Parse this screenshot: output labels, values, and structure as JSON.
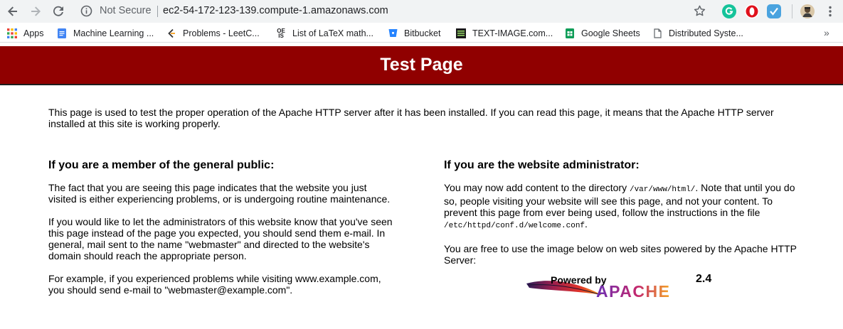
{
  "browser": {
    "security_label": "Not Secure",
    "url": "ec2-54-172-123-139.compute-1.amazonaws.com",
    "bookmarks": [
      {
        "label": "Apps",
        "icon": "apps-grid-icon"
      },
      {
        "label": "Machine Learning ...",
        "icon": "google-docs-icon"
      },
      {
        "label": "Problems - LeetC...",
        "icon": "leetcode-icon"
      },
      {
        "label": "List of LaTeX math...",
        "icon": "oeis-icon"
      },
      {
        "label": "Bitbucket",
        "icon": "bitbucket-icon"
      },
      {
        "label": "TEXT-IMAGE.com...",
        "icon": "text-image-icon"
      },
      {
        "label": "Google Sheets",
        "icon": "google-sheets-icon"
      },
      {
        "label": "Distributed Syste...",
        "icon": "page-icon"
      }
    ],
    "more_label": "»"
  },
  "page": {
    "title": "Test Page",
    "intro": "This page is used to test the proper operation of the Apache HTTP server after it has been installed. If you can read this page, it means that the Apache HTTP server installed at this site is working properly.",
    "public": {
      "heading": "If you are a member of the general public:",
      "p1": "The fact that you are seeing this page indicates that the website you just visited is either experiencing problems, or is undergoing routine maintenance.",
      "p2": "If you would like to let the administrators of this website know that you've seen this page instead of the page you expected, you should send them e-mail. In general, mail sent to the name \"webmaster\" and directed to the website's domain should reach the appropriate person.",
      "p3": "For example, if you experienced problems while visiting www.example.com, you should send e-mail to \"webmaster@example.com\"."
    },
    "admin": {
      "heading": "If you are the website administrator:",
      "p1_a": "You may now add content to the directory ",
      "p1_dir": "/var/www/html/",
      "p1_b": ". Note that until you do so, people visiting your website will see this page, and not your content. To prevent this page from ever being used, follow the instructions in the file ",
      "p1_file": "/etc/httpd/conf.d/welcome.conf",
      "p1_c": ".",
      "p2": "You are free to use the image below on web sites powered by the Apache HTTP Server:"
    },
    "logo": {
      "powered": "Powered by",
      "version": "2.4",
      "word": "APACHE"
    }
  },
  "colors": {
    "banner": "#900000",
    "chrome": "#f1f3f4"
  }
}
